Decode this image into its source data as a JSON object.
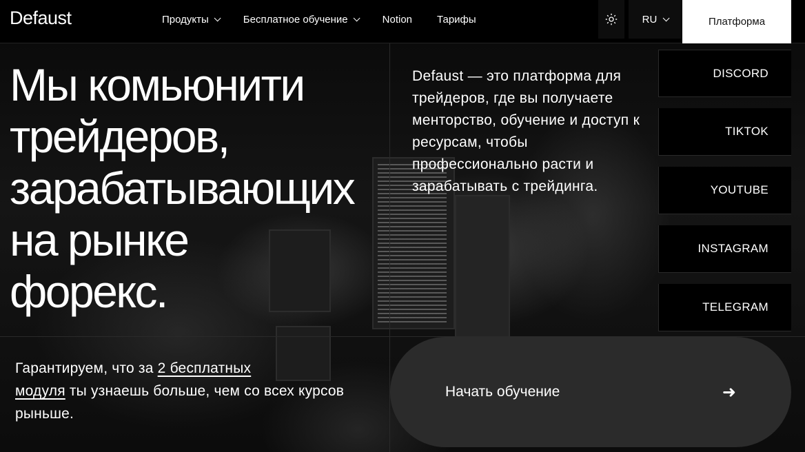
{
  "header": {
    "logo": "Defaust",
    "nav": [
      {
        "label": "Продукты",
        "has_dropdown": true
      },
      {
        "label": "Бесплатное обучение",
        "has_dropdown": true
      },
      {
        "label": "Notion",
        "has_dropdown": false
      },
      {
        "label": "Тарифы",
        "has_dropdown": false
      }
    ],
    "theme_icon": "sun-icon",
    "language": "RU",
    "platform_label": "Платформа"
  },
  "hero": {
    "title_lines": [
      "Мы комьюнити",
      "трейдеров,",
      "зарабатывающих",
      "на рынке",
      "форекс."
    ],
    "description": "Defaust — это платформа для трейдеров, где вы получаете менторство, обучение и доступ к ресурсам, чтобы профессионально расти и зарабатывать с трейдинга."
  },
  "social": [
    "DISCORD",
    "TIKTOK",
    "YOUTUBE",
    "INSTAGRAM",
    "TELEGRAM"
  ],
  "guarantee": {
    "before": "Гарантируем, что за ",
    "link_part1": "2 бесплатных",
    "link_part2": "модуля",
    "after": " ты узнаешь больше, чем со всех курсов рыньше."
  },
  "cta": {
    "label": "Начать обучение",
    "arrow": "➜"
  }
}
